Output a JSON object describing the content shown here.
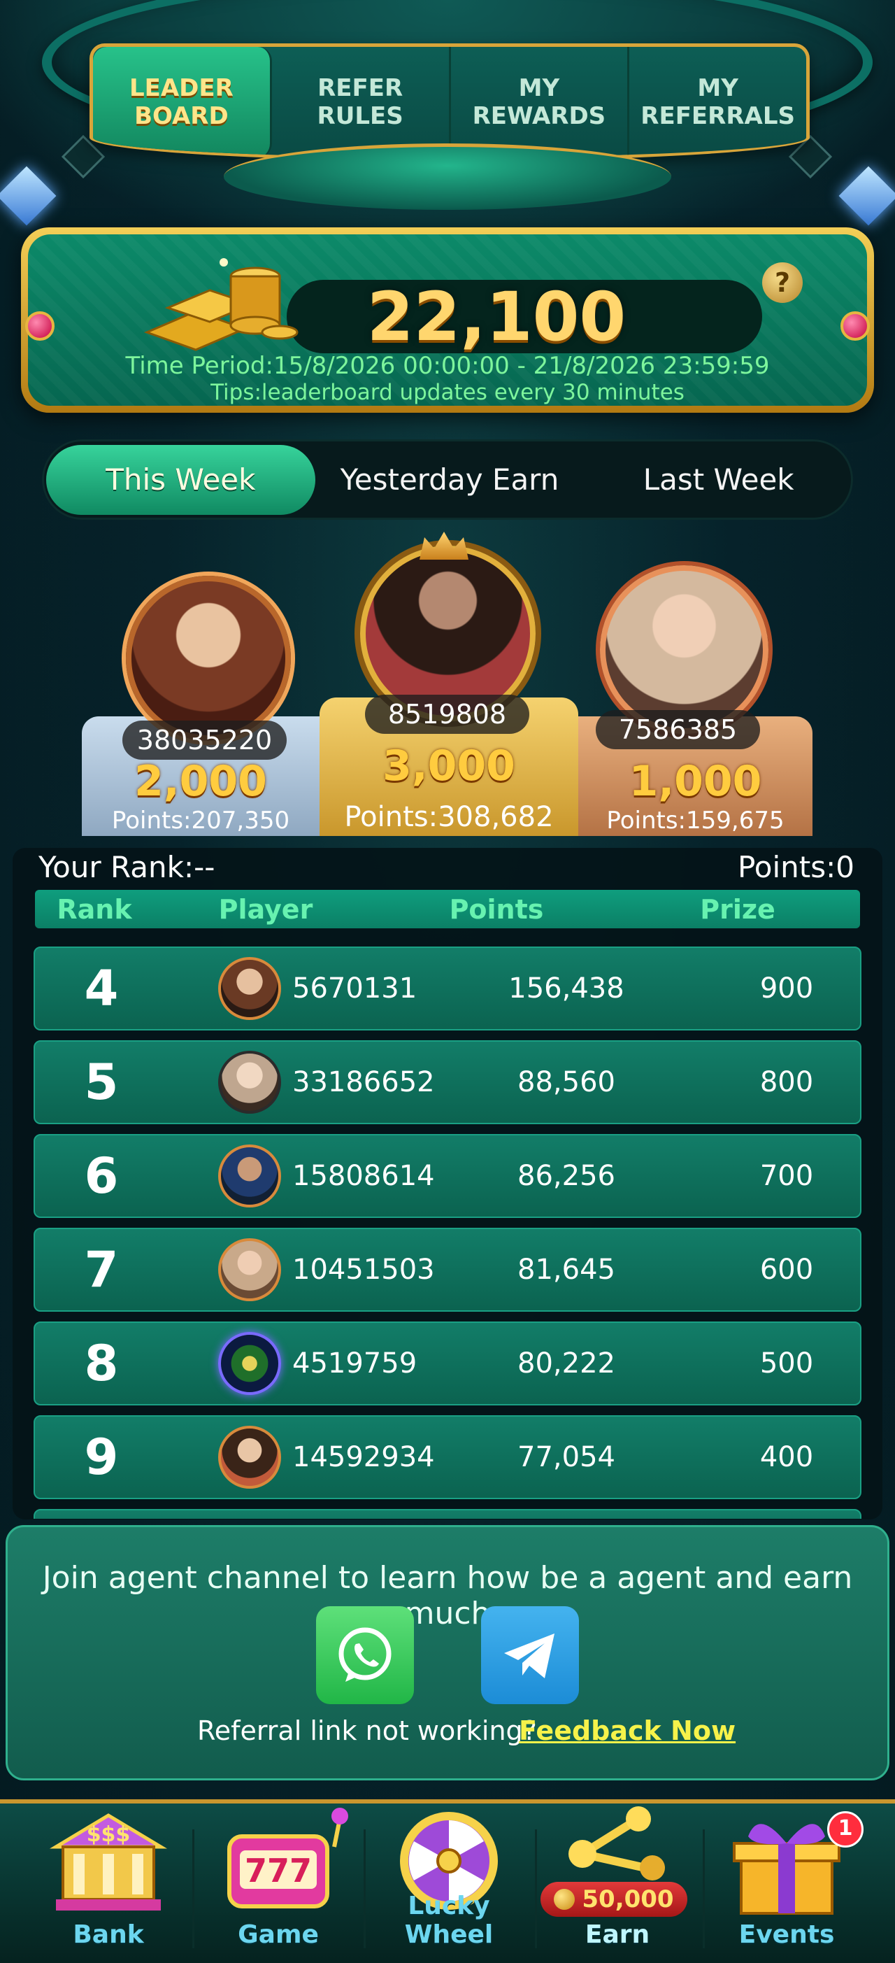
{
  "tabs": [
    {
      "label": "LEADER\nBOARD",
      "active": true
    },
    {
      "label": "REFER\nRULES",
      "active": false
    },
    {
      "label": "MY\nREWARDS",
      "active": false
    },
    {
      "label": "MY\nREFERRALS",
      "active": false
    }
  ],
  "prize_banner": {
    "amount": "22,100",
    "help": "?",
    "time_period": "Time Period:15/8/2026 00:00:00 - 21/8/2026 23:59:59",
    "tips": "Tips:leaderboard updates every 30 minutes"
  },
  "period_tabs": [
    {
      "label": "This Week",
      "active": true
    },
    {
      "label": "Yesterday Earn",
      "active": false
    },
    {
      "label": "Last Week",
      "active": false
    }
  ],
  "podium": {
    "second": {
      "id": "38035220",
      "prize": "2,000",
      "points": "Points:207,350"
    },
    "first": {
      "id": "8519808",
      "prize": "3,000",
      "points": "Points:308,682"
    },
    "third": {
      "id": "7586385",
      "prize": "1,000",
      "points": "Points:159,675"
    }
  },
  "rank_table": {
    "your_rank": "Your Rank:--",
    "your_points": "Points:0",
    "headers": {
      "rank": "Rank",
      "player": "Player",
      "points": "Points",
      "prize": "Prize"
    },
    "rows": [
      {
        "rank": "4",
        "player": "5670131",
        "points": "156,438",
        "prize": "900"
      },
      {
        "rank": "5",
        "player": "33186652",
        "points": "88,560",
        "prize": "800"
      },
      {
        "rank": "6",
        "player": "15808614",
        "points": "86,256",
        "prize": "700"
      },
      {
        "rank": "7",
        "player": "10451503",
        "points": "81,645",
        "prize": "600"
      },
      {
        "rank": "8",
        "player": "4519759",
        "points": "80,222",
        "prize": "500"
      },
      {
        "rank": "9",
        "player": "14592934",
        "points": "77,054",
        "prize": "400"
      }
    ]
  },
  "agent_panel": {
    "message": "Join agent channel to learn how be a agent and earn much",
    "referral_note": "Referral link not working?",
    "feedback_link": "Feedback Now",
    "whatsapp_icon": "whatsapp-icon",
    "telegram_icon": "telegram-icon"
  },
  "bottom_nav": {
    "bank": "Bank",
    "game": "Game",
    "lucky_wheel": "Lucky Wheel",
    "refer_earn": "Refer & Earn",
    "events": "Events",
    "refer_coin_amount": "50,000",
    "events_badge": "1"
  },
  "colors": {
    "accent_green": "#12865e",
    "gold": "#d8a53a",
    "prize_text": "#ffd66e",
    "tips_text": "#7df59c",
    "feedback_link": "#f6f24a"
  }
}
